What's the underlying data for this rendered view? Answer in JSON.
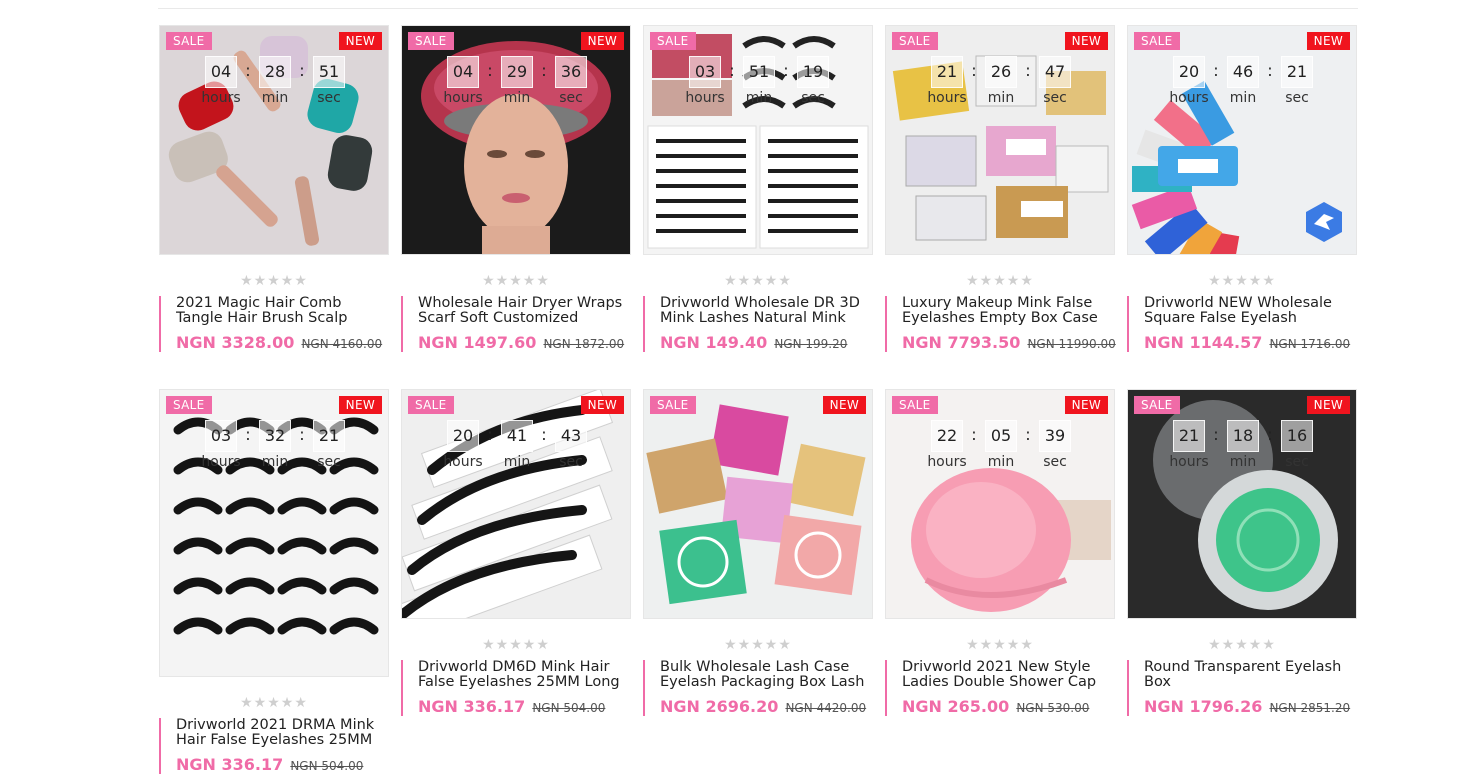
{
  "labels": {
    "sale": "SALE",
    "new": "NEW",
    "hours": "hours",
    "min": "min",
    "sec": "sec",
    "stars": "★★★★★"
  },
  "products": [
    {
      "title": "2021 Magic Hair Comb Tangle Hair Brush Scalp",
      "price": "NGN 3328.00",
      "old_price": "NGN 4160.00",
      "countdown": [
        "04",
        "28",
        "51"
      ],
      "rating": 0,
      "image_icon": "hair-brush-icon",
      "colors": [
        "#d9d4d6",
        "#c0131c",
        "#b8b0b4"
      ]
    },
    {
      "title": "Wholesale Hair Dryer Wraps Scarf Soft Customized",
      "price": "NGN 1497.60",
      "old_price": "NGN 1872.00",
      "countdown": [
        "04",
        "29",
        "36"
      ],
      "rating": 0,
      "image_icon": "mannequin-icon",
      "colors": [
        "#1a1a1a",
        "#b3324a",
        "#e0b295"
      ]
    },
    {
      "title": "Drivworld Wholesale DR 3D Mink Lashes Natural Mink",
      "price": "NGN 149.40",
      "old_price": "NGN 199.20",
      "countdown": [
        "03",
        "51",
        "19"
      ],
      "rating": 0,
      "image_icon": "lashes-icon",
      "colors": [
        "#f4f4f4",
        "#222222",
        "#d8a3a8"
      ]
    },
    {
      "title": "Luxury Makeup Mink False Eyelashes Empty Box Case",
      "price": "NGN 7793.50",
      "old_price": "NGN 11990.00",
      "countdown": [
        "21",
        "26",
        "47"
      ],
      "rating": 0,
      "image_icon": "lash-box-icon",
      "colors": [
        "#eeeeee",
        "#e9c84a",
        "#e6a4cc"
      ]
    },
    {
      "title": "Drivworld NEW Wholesale Square False Eyelash",
      "price": "NGN 1144.57",
      "old_price": "NGN 1716.00",
      "countdown": [
        "20",
        "46",
        "21"
      ],
      "rating": 0,
      "image_icon": "lash-case-fan-icon",
      "colors": [
        "#f2f2f4",
        "#e94e63",
        "#3b9be0"
      ]
    },
    {
      "title": "Drivworld 2021 DRMA Mink Hair False Eyelashes 25MM",
      "price": "NGN 336.17",
      "old_price": "NGN 504.00",
      "countdown": [
        "03",
        "32",
        "21"
      ],
      "rating": 0,
      "image_icon": "lashes-tray-icon",
      "colors": [
        "#f6f6f6",
        "#1a1a1a",
        "#e5e5e5"
      ]
    },
    {
      "title": "Drivworld DM6D Mink Hair False Eyelashes 25MM Long",
      "price": "NGN 336.17",
      "old_price": "NGN 504.00",
      "countdown": [
        "20",
        "41",
        "43"
      ],
      "rating": 0,
      "image_icon": "lashes-stack-icon",
      "colors": [
        "#f1f1f1",
        "#161616",
        "#d0d0d0"
      ]
    },
    {
      "title": "Bulk Wholesale Lash Case Eyelash Packaging Box Lash",
      "price": "NGN 2696.20",
      "old_price": "NGN 4420.00",
      "countdown": [],
      "rating": 0,
      "image_icon": "glitter-box-icon",
      "colors": [
        "#eef0f0",
        "#e25aa8",
        "#3fbf94"
      ]
    },
    {
      "title": "Drivworld 2021 New Style Ladies Double Shower Cap",
      "price": "NGN 265.00",
      "old_price": "NGN 530.00",
      "countdown": [
        "22",
        "05",
        "39"
      ],
      "rating": 0,
      "image_icon": "shower-cap-icon",
      "colors": [
        "#f3f1f0",
        "#f59bb0",
        "#d9c7bd"
      ]
    },
    {
      "title": "Round Transparent Eyelash Box",
      "price": "NGN 1796.26",
      "old_price": "NGN 2851.20",
      "countdown": [
        "21",
        "18",
        "16"
      ],
      "rating": 0,
      "image_icon": "round-case-icon",
      "colors": [
        "#2a2a2a",
        "#3ec48a",
        "#c9cccd"
      ]
    }
  ]
}
